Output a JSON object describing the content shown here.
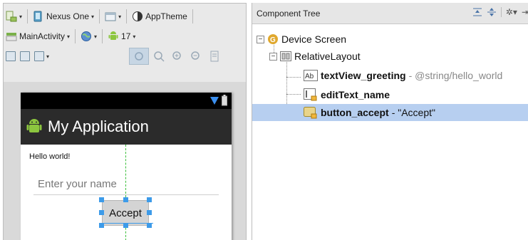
{
  "designer": {
    "toolbar": {
      "device": "Nexus One",
      "theme": "AppTheme",
      "activity": "MainActivity",
      "api_level": "17"
    },
    "phone": {
      "app_title": "My Application",
      "hello_text": "Hello world!",
      "name_placeholder": "Enter your name",
      "button_label": "Accept"
    }
  },
  "component_tree": {
    "title": "Component Tree",
    "nodes": [
      {
        "label": "Device Screen",
        "suffix": ""
      },
      {
        "label": "RelativeLayout",
        "suffix": ""
      },
      {
        "label": "textView_greeting",
        "suffix": " - @string/hello_world"
      },
      {
        "label": "editText_name",
        "suffix": ""
      },
      {
        "label": "button_accept",
        "suffix": " - \"Accept\""
      }
    ],
    "selected_index": 4
  },
  "colors": {
    "selection": "#b7cff0",
    "handle": "#3d9be9",
    "guide": "#3bbf3b",
    "action_bar": "#2b2b2b"
  }
}
